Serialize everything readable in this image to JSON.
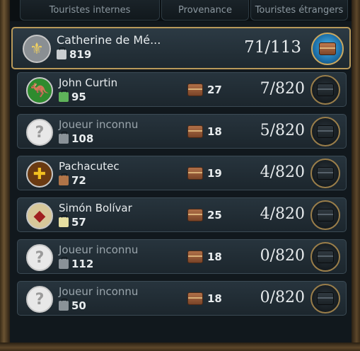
{
  "header": {
    "col_domestic": "Touristes internes",
    "col_origin": "Provenance",
    "col_foreign": "Touristes étrangers"
  },
  "colors": {
    "frame": "#6b5332",
    "selected_border": "#b99a5a",
    "row_bg": "#27343d",
    "text": "#e8ecee",
    "unknown_text": "#9aa5ac",
    "origin_chest": "#b07048",
    "selected_button": "#1c6fa8"
  },
  "players": [
    {
      "name": "Catherine de Mé...",
      "emblem_icon": "fleur-de-lis-icon",
      "emblem_glyph": "⚜",
      "emblem_bg": "#8a8f93",
      "emblem_fg": "#f0d060",
      "tourist_icon_color": "#c9cdd0",
      "domestic_tourists": "819",
      "origin_count": "",
      "score": "71/113",
      "selected": true,
      "unknown": false
    },
    {
      "name": "John Curtin",
      "emblem_icon": "kangaroo-icon",
      "emblem_glyph": "🦘",
      "emblem_bg": "#2e8b2e",
      "emblem_fg": "#f0d060",
      "tourist_icon_color": "#5fb35a",
      "domestic_tourists": "95",
      "origin_count": "27",
      "score": "7/820",
      "selected": false,
      "unknown": false
    },
    {
      "name": "Joueur inconnu",
      "emblem_icon": "question-mark-icon",
      "emblem_glyph": "?",
      "emblem_bg": "#e8e8e8",
      "emblem_fg": "#9a9a9a",
      "tourist_icon_color": "#8a9298",
      "domestic_tourists": "108",
      "origin_count": "18",
      "score": "5/820",
      "selected": false,
      "unknown": true
    },
    {
      "name": "Pachacutec",
      "emblem_icon": "inca-cross-icon",
      "emblem_glyph": "✚",
      "emblem_bg": "#6a3a12",
      "emblem_fg": "#f2c020",
      "tourist_icon_color": "#b07448",
      "domestic_tourists": "72",
      "origin_count": "19",
      "score": "4/820",
      "selected": false,
      "unknown": false
    },
    {
      "name": "Simón Bolívar",
      "emblem_icon": "shield-crest-icon",
      "emblem_glyph": "◆",
      "emblem_bg": "#d8c89a",
      "emblem_fg": "#a02020",
      "tourist_icon_color": "#e6dfa2",
      "domestic_tourists": "57",
      "origin_count": "25",
      "score": "4/820",
      "selected": false,
      "unknown": false
    },
    {
      "name": "Joueur inconnu",
      "emblem_icon": "question-mark-icon",
      "emblem_glyph": "?",
      "emblem_bg": "#e8e8e8",
      "emblem_fg": "#9a9a9a",
      "tourist_icon_color": "#8a9298",
      "domestic_tourists": "112",
      "origin_count": "18",
      "score": "0/820",
      "selected": false,
      "unknown": true
    },
    {
      "name": "Joueur inconnu",
      "emblem_icon": "question-mark-icon",
      "emblem_glyph": "?",
      "emblem_bg": "#e8e8e8",
      "emblem_fg": "#9a9a9a",
      "tourist_icon_color": "#8a9298",
      "domestic_tourists": "50",
      "origin_count": "18",
      "score": "0/820",
      "selected": false,
      "unknown": true
    }
  ]
}
